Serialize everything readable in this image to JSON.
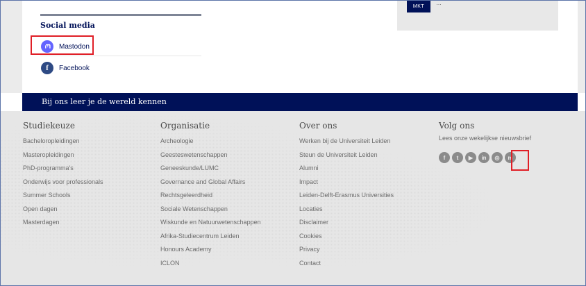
{
  "social": {
    "title": "Social media",
    "items": [
      {
        "label": "Mastodon",
        "icon": "mastodon-icon"
      },
      {
        "label": "Facebook",
        "icon": "facebook-icon"
      }
    ]
  },
  "partial_box": {
    "button_label": "MKT",
    "text": "…"
  },
  "banner": {
    "text": "Bij ons leer je de wereld kennen"
  },
  "footer": {
    "columns": [
      {
        "title": "Studiekeuze",
        "links": [
          "Bacheloropleidingen",
          "Masteropleidingen",
          "PhD-programma's",
          "Onderwijs voor professionals",
          "Summer Schools",
          "Open dagen",
          "Masterdagen"
        ]
      },
      {
        "title": "Organisatie",
        "links": [
          "Archeologie",
          "Geesteswetenschappen",
          "Geneeskunde/LUMC",
          "Governance and Global Affairs",
          "Rechtsgeleerdheid",
          "Sociale Wetenschappen",
          "Wiskunde en Natuurwetenschappen",
          "Afrika-Studiecentrum Leiden",
          "Honours Academy",
          "ICLON"
        ]
      },
      {
        "title": "Over ons",
        "links": [
          "Werken bij de Universiteit Leiden",
          "Steun de Universiteit Leiden",
          "Alumni",
          "Impact",
          "Leiden-Delft-Erasmus Universities",
          "Locaties",
          "Disclaimer",
          "Cookies",
          "Privacy",
          "Contact"
        ]
      }
    ],
    "follow": {
      "title": "Volg ons",
      "newsletter": "Lees onze wekelijkse nieuwsbrief",
      "icons": [
        {
          "name": "facebook-icon",
          "glyph": "f"
        },
        {
          "name": "twitter-icon",
          "glyph": "t"
        },
        {
          "name": "youtube-icon",
          "glyph": "▶"
        },
        {
          "name": "linkedin-icon",
          "glyph": "in"
        },
        {
          "name": "instagram-icon",
          "glyph": "◎"
        },
        {
          "name": "mastodon-icon",
          "glyph": "m"
        }
      ]
    }
  },
  "colors": {
    "navy": "#001158",
    "highlight": "#e01e26",
    "mastodon": "#6364ff",
    "facebook": "#2e4a84"
  }
}
